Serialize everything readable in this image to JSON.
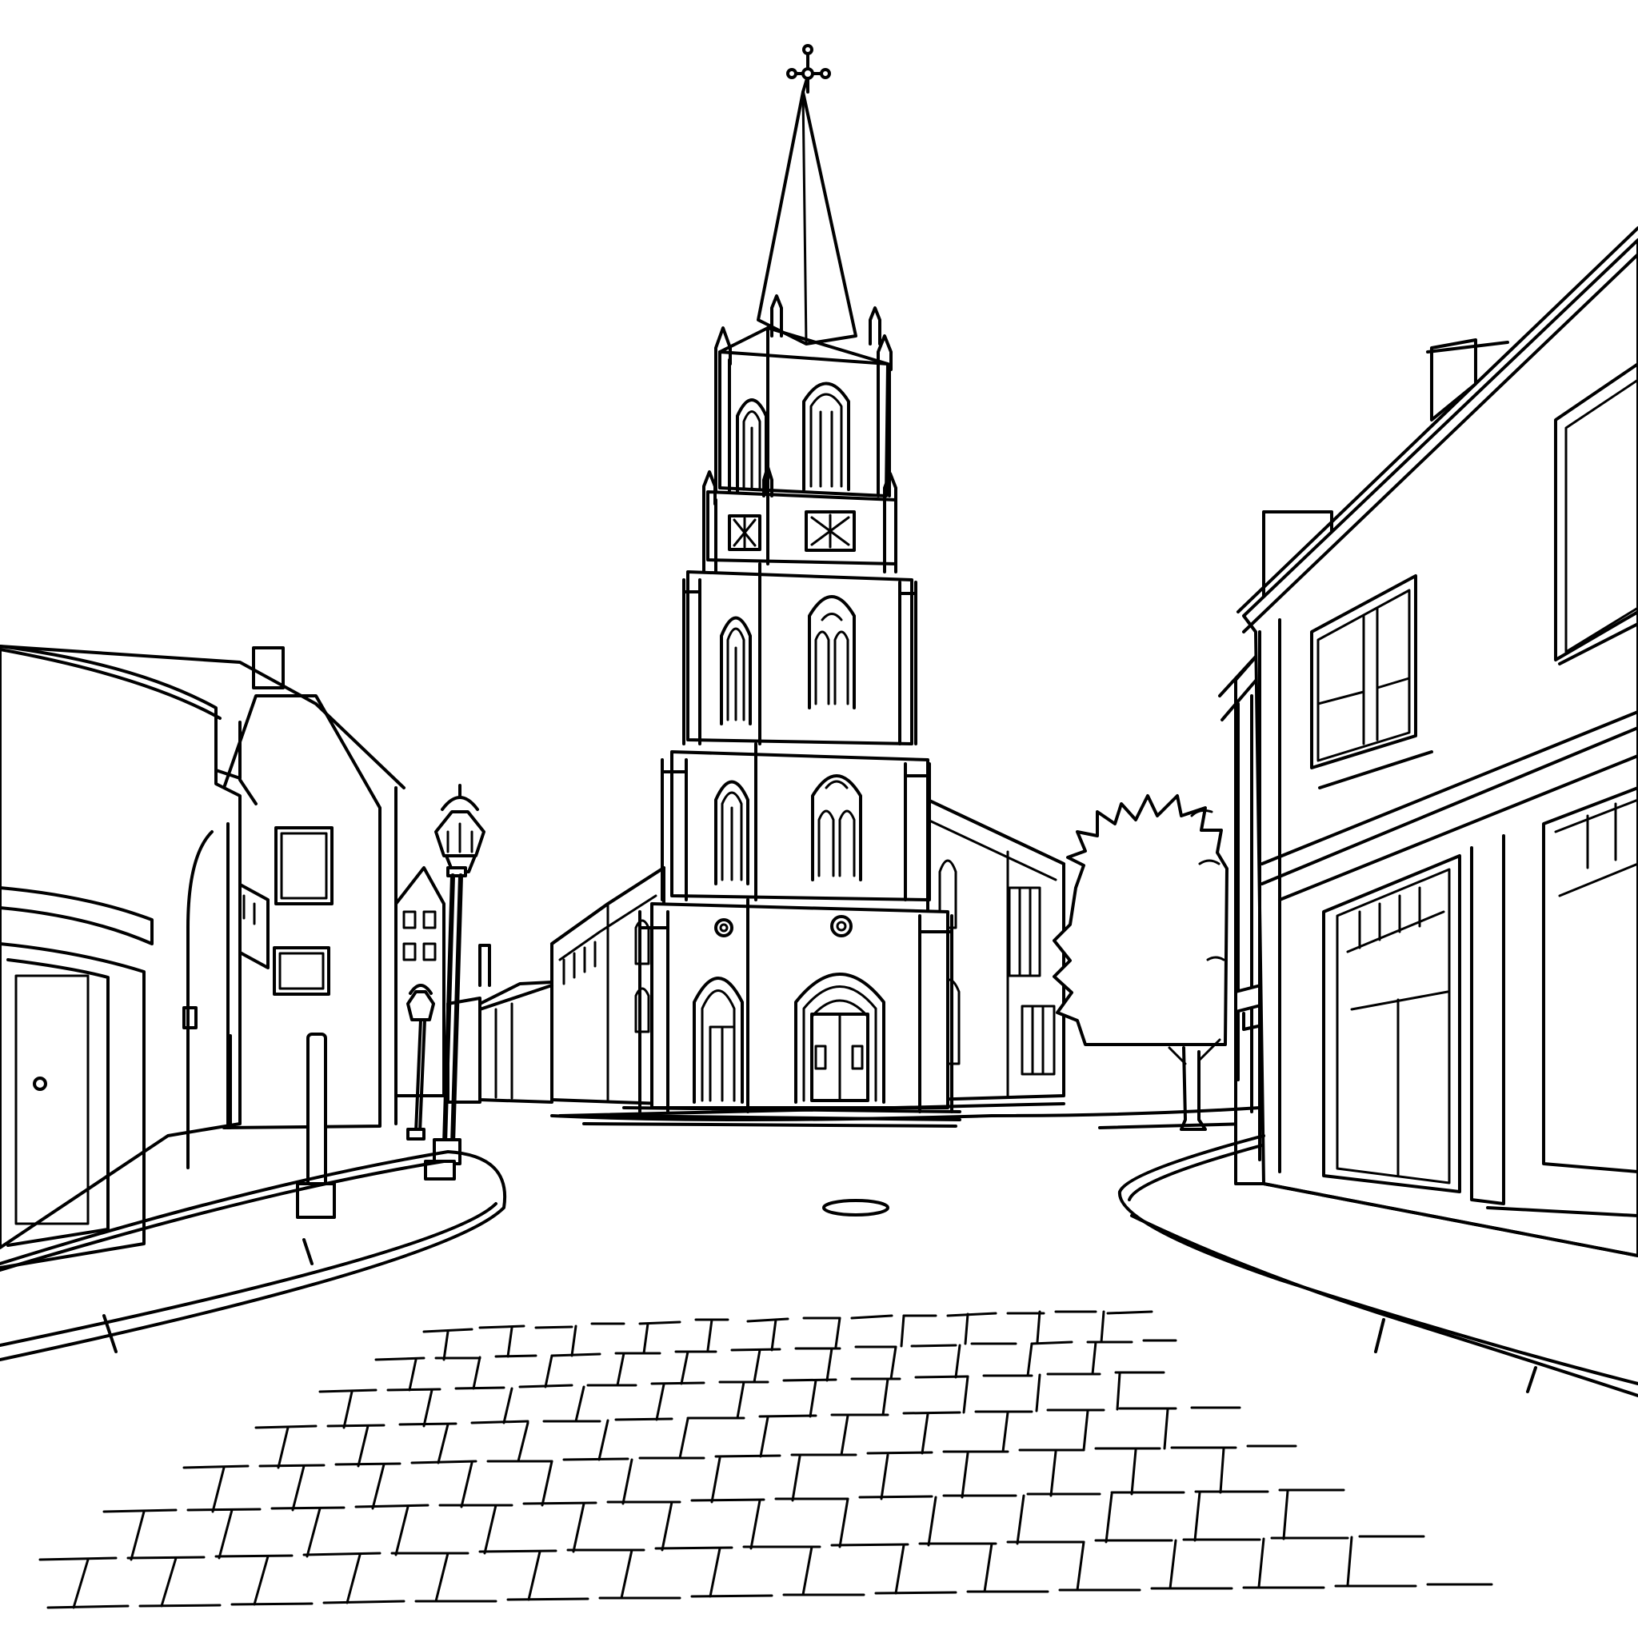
{
  "scene": {
    "style": "black-and-white line art",
    "colors": {
      "ink": "#000000",
      "paper": "#ffffff"
    },
    "subjects": [
      "church",
      "spire",
      "street",
      "cobblestones",
      "street-lamps",
      "houses",
      "shops",
      "tree",
      "bollard",
      "manhole-cover"
    ]
  }
}
